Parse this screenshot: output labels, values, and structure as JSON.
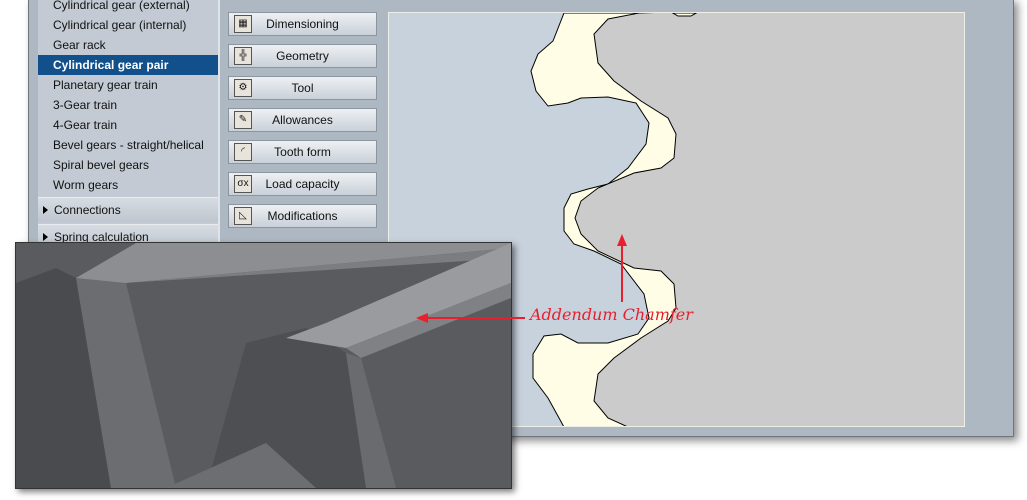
{
  "sidebar": {
    "items": [
      "Cylindrical gear (external)",
      "Cylindrical gear (internal)",
      "Gear rack",
      "Cylindrical gear pair",
      "Planetary gear train",
      "3-Gear train",
      "4-Gear train",
      "Bevel gears - straight/helical",
      "Spiral bevel gears",
      "Worm gears"
    ],
    "selected": "Cylindrical gear pair",
    "groups": [
      "Connections",
      "Spring calculation"
    ]
  },
  "buttons": [
    {
      "label": "Dimensioning",
      "icon": "calculator-icon"
    },
    {
      "label": "Geometry",
      "icon": "grid-icon"
    },
    {
      "label": "Tool",
      "icon": "tool-gear-icon"
    },
    {
      "label": "Allowances",
      "icon": "allowances-icon"
    },
    {
      "label": "Tooth form",
      "icon": "tooth-form-icon"
    },
    {
      "label": "Load capacity",
      "icon": "load-capacity-icon"
    },
    {
      "label": "Modifications",
      "icon": "modifications-icon"
    }
  ],
  "annotation": {
    "label": "Addendum Chamfer",
    "color": "#e8202e"
  },
  "colors": {
    "selection": "#11508b",
    "gear_left": "#fffde6",
    "gear_right": "#cbcbcb",
    "canvas": "#c8d2dd"
  }
}
